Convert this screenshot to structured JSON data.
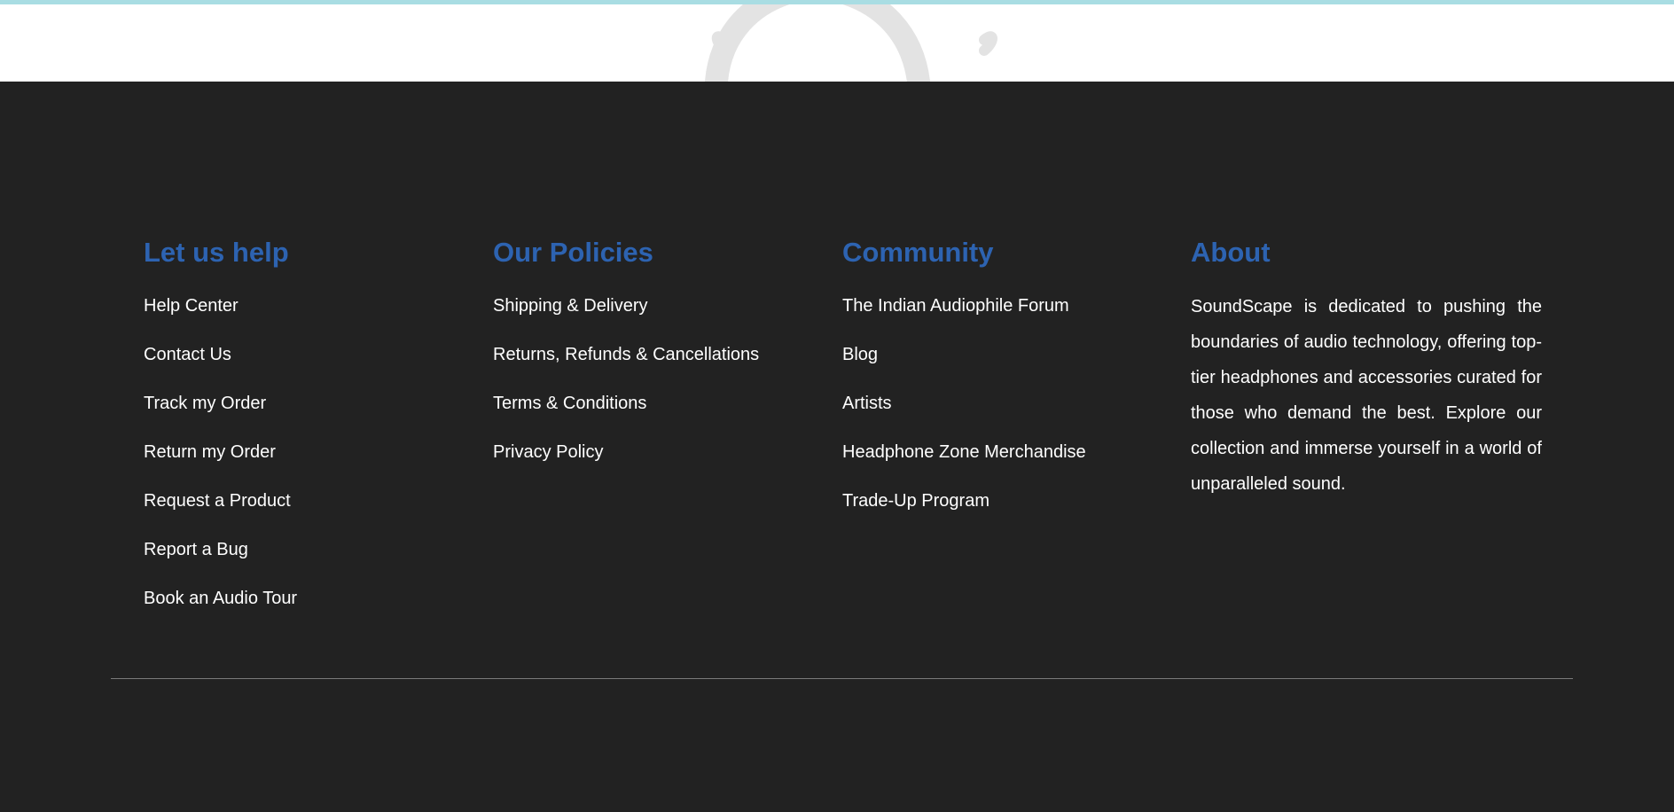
{
  "colors": {
    "heading": "#2d63b1",
    "footer_bg": "#222222",
    "link": "#ffffff",
    "divider": "#7a7a7a",
    "top_strip": "#a9dde3"
  },
  "hero": {
    "decoration_icon": "headphones-icon"
  },
  "footer": {
    "columns": [
      {
        "heading": "Let us help",
        "links": [
          "Help Center",
          "Contact Us",
          "Track my Order",
          "Return my Order",
          "Request a Product",
          "Report a Bug",
          "Book an Audio Tour"
        ]
      },
      {
        "heading": "Our Policies",
        "links": [
          "Shipping & Delivery",
          "Returns, Refunds & Cancellations",
          "Terms & Conditions",
          "Privacy Policy"
        ]
      },
      {
        "heading": "Community",
        "links": [
          "The Indian Audiophile Forum",
          "Blog",
          "Artists",
          "Headphone Zone Merchandise",
          "Trade-Up Program"
        ]
      }
    ],
    "about": {
      "heading": "About",
      "text": "SoundScape is dedicated to pushing the boundaries of audio technology, offering top-tier headphones and accessories curated for those who demand the best. Explore our collection and immerse yourself in a world of unparalleled sound."
    }
  }
}
